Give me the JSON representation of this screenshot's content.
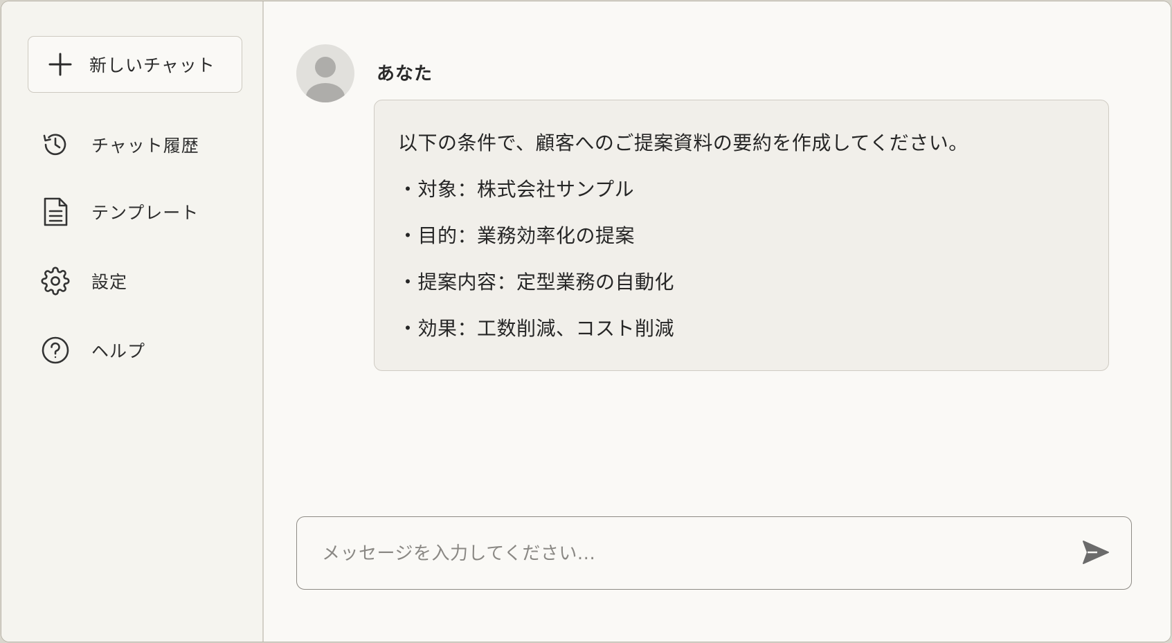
{
  "sidebar": {
    "new_chat": {
      "icon": "plus-icon",
      "label": "新しいチャット"
    },
    "items": [
      {
        "icon": "history-icon",
        "label": "チャット履歴"
      },
      {
        "icon": "document-icon",
        "label": "テンプレート"
      },
      {
        "icon": "gear-icon",
        "label": "設定"
      },
      {
        "icon": "help-icon",
        "label": "ヘルプ"
      }
    ]
  },
  "conversation": {
    "user": {
      "avatar": "avatar-icon",
      "name": "あなた"
    },
    "message": {
      "intro": "以下の条件で、顧客へのご提案資料の要約を作成してください。",
      "bullets": [
        "・対象：株式会社サンプル",
        "・目的：業務効率化の提案",
        "・提案内容：定型業務の自動化",
        "・効果：工数削減、コスト削減"
      ]
    }
  },
  "composer": {
    "placeholder": "メッセージを入力してください...",
    "value": "",
    "send_icon": "send-icon"
  }
}
